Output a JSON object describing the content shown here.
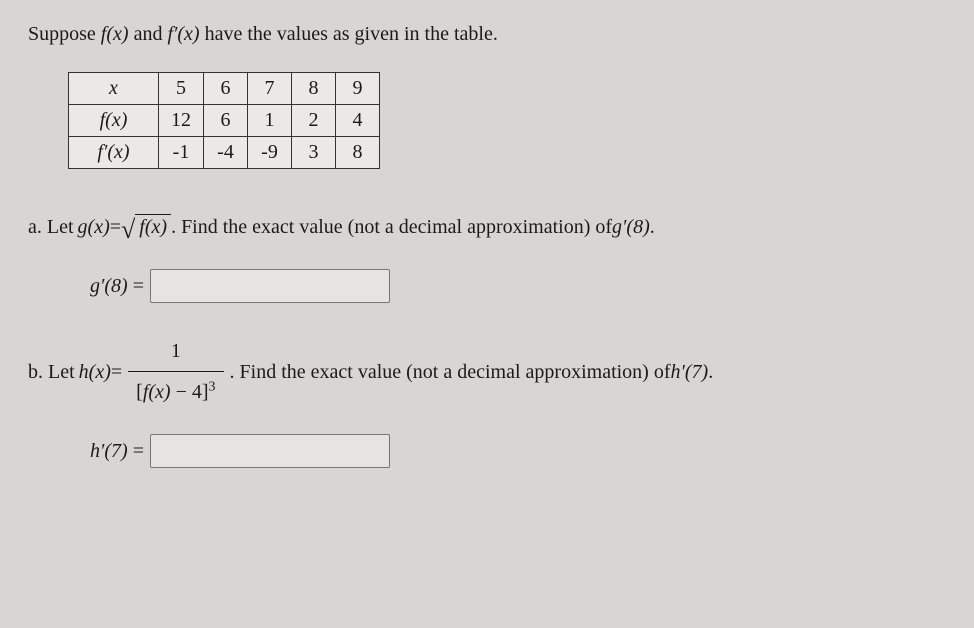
{
  "intro": {
    "prefix": "Suppose ",
    "f": "f(x)",
    "and": " and ",
    "fprime": "f′(x)",
    "suffix": " have the values as given in the table."
  },
  "table": {
    "headers": {
      "x": "x",
      "fx": "f(x)",
      "fpx": "f′(x)"
    },
    "x": [
      "5",
      "6",
      "7",
      "8",
      "9"
    ],
    "fx": [
      "12",
      "6",
      "1",
      "2",
      "4"
    ],
    "fpx": [
      "-1",
      "-4",
      "-9",
      "3",
      "8"
    ]
  },
  "partA": {
    "lead": "a. Let ",
    "gx": "g(x)",
    "eq": " = ",
    "sqrt_inner": "f(x)",
    "tail": ". Find the exact value (not a decimal approximation) of ",
    "target": "g′(8)",
    "period": ".",
    "answer_label_lhs": "g′(8)",
    "answer_eq": " ="
  },
  "partB": {
    "lead": "b. Let ",
    "hx": "h(x)",
    "eq": " = ",
    "num": "1",
    "den_left": "[",
    "den_fx": "f(x)",
    "den_mid": " − 4]",
    "den_exp": "3",
    "tail": ". Find the exact value (not a decimal approximation) of ",
    "target": "h′(7)",
    "period": ".",
    "answer_label_lhs": "h′(7)",
    "answer_eq": " ="
  }
}
